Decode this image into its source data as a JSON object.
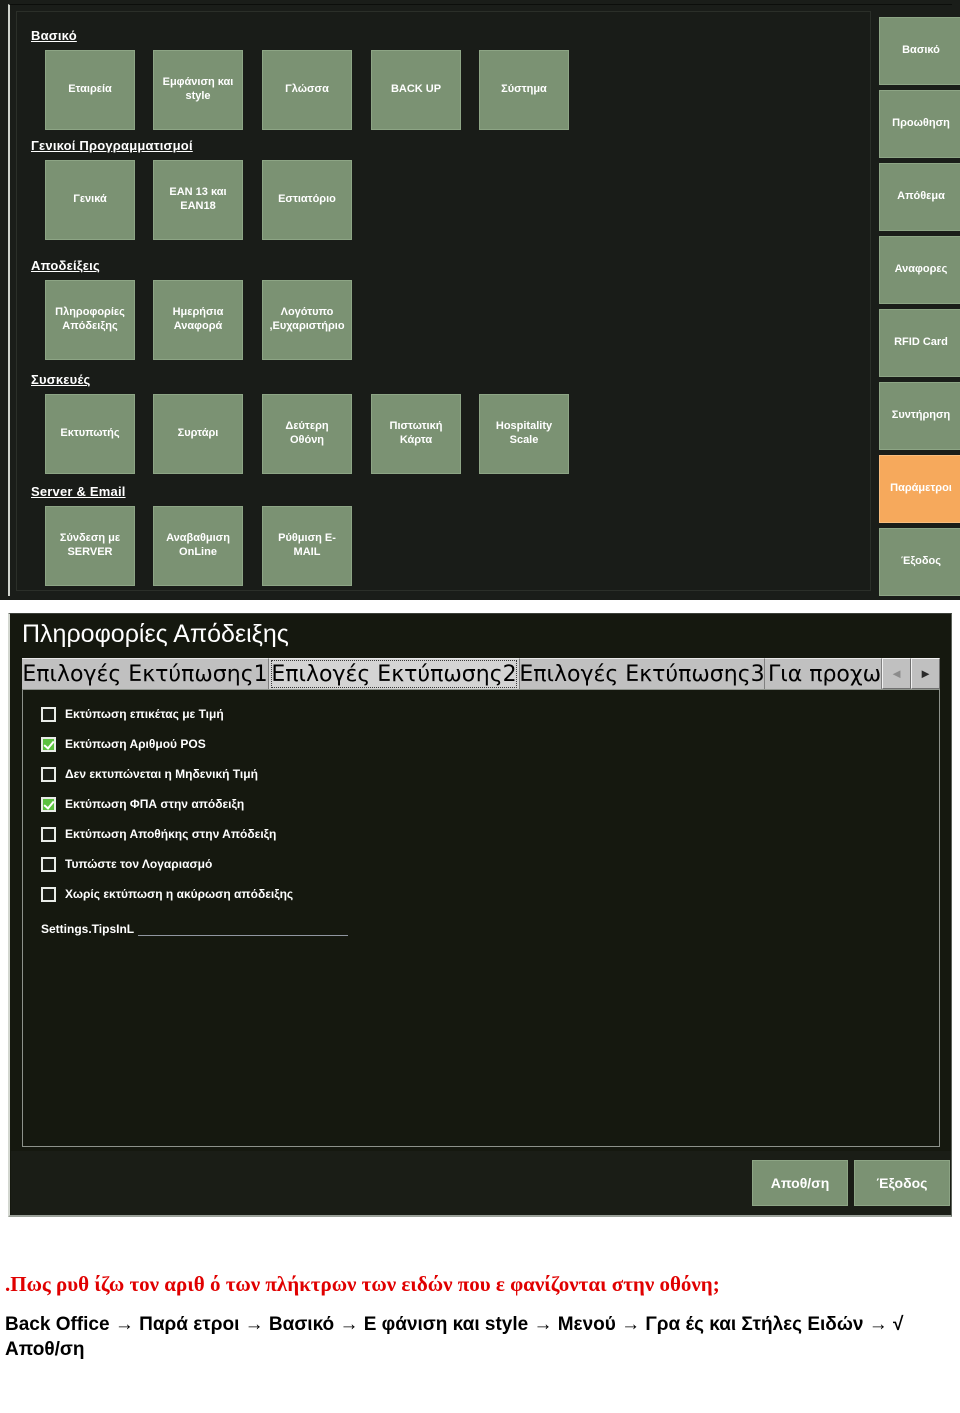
{
  "backoffice": {
    "groups": [
      {
        "name": "basiko",
        "header": "Βασικό",
        "tiles": [
          {
            "label": "Εταιρεία",
            "name": "tile-etaireia"
          },
          {
            "label": "Εμφάνιση και\nstyle",
            "name": "tile-emfanisi-style"
          },
          {
            "label": "Γλώσσα",
            "name": "tile-glossa"
          },
          {
            "label": "BACK UP",
            "name": "tile-backup"
          },
          {
            "label": "Σύστημα",
            "name": "tile-systima"
          }
        ]
      },
      {
        "name": "genikoi-programmatismoi",
        "header": "Γενικοί Προγραμματισμοί",
        "tiles": [
          {
            "label": "Γενικά",
            "name": "tile-genika"
          },
          {
            "label": "EAN 13 και\nEAN18",
            "name": "tile-ean13-ean18"
          },
          {
            "label": "Εστιατόριο",
            "name": "tile-estiatorio"
          }
        ]
      },
      {
        "name": "apodeixeis",
        "header": "Αποδείξεις",
        "tiles": [
          {
            "label": "Πληροφορίες\nΑπόδειξης",
            "name": "tile-plirofories-apodeixis"
          },
          {
            "label": "Ημερήσια\nΑναφορά",
            "name": "tile-imerisia-anafora"
          },
          {
            "label": "Λογότυπο\n,Ευχαριστήριο",
            "name": "tile-logotypo-euxaristirio"
          }
        ]
      },
      {
        "name": "syskeues",
        "header": "Συσκευές",
        "tiles": [
          {
            "label": "Εκτυπωτής",
            "name": "tile-ektypotis"
          },
          {
            "label": "Συρτάρι",
            "name": "tile-syrtari"
          },
          {
            "label": "Δεύτερη\nΟθόνη",
            "name": "tile-defteri-othoni"
          },
          {
            "label": "Πιστωτική\nΚάρτα",
            "name": "tile-pistotiki-karta"
          },
          {
            "label": "Hospitality\nScale",
            "name": "tile-hospitality-scale"
          }
        ]
      },
      {
        "name": "server-email",
        "header": "Server & Email",
        "tiles": [
          {
            "label": "Σύνδεση με\nSERVER",
            "name": "tile-syndesi-server"
          },
          {
            "label": "Αναβαθμιση\nOnLine",
            "name": "tile-anavathmisi-online"
          },
          {
            "label": "Ρύθμιση E-\nMAIL",
            "name": "tile-rythmisi-email"
          }
        ]
      }
    ],
    "sidebar": {
      "items": [
        {
          "label": "Βασικό",
          "name": "sidebar-basiko",
          "active": false
        },
        {
          "label": "Προωθηση",
          "name": "sidebar-proothisi",
          "active": false
        },
        {
          "label": "Απόθεμα",
          "name": "sidebar-apothema",
          "active": false
        },
        {
          "label": "Αναφορες",
          "name": "sidebar-anafores",
          "active": false
        },
        {
          "label": "RFID Card",
          "name": "sidebar-rfid-card",
          "active": false
        },
        {
          "label": "Συντήρηση",
          "name": "sidebar-syntirisi",
          "active": false
        },
        {
          "label": "Παράμετροι",
          "name": "sidebar-parametroi",
          "active": true
        },
        {
          "label": "Έξοδος",
          "name": "sidebar-exodos",
          "active": false
        }
      ],
      "active_color": "#f6a95c",
      "tile_color": "#7b9273"
    }
  },
  "dialog": {
    "title": "Πληροφορίες Απόδειξης",
    "tabs": [
      {
        "label": "Επιλογές Εκτύπωσης1",
        "selected": false,
        "name": "tab-print-options-1"
      },
      {
        "label": "Επιλογές Εκτύπωσης2",
        "selected": true,
        "name": "tab-print-options-2"
      },
      {
        "label": "Επιλογές Εκτύπωσης3",
        "selected": false,
        "name": "tab-print-options-3"
      },
      {
        "label": "Για προχωρημ",
        "selected": false,
        "name": "tab-gia-proxorimenous"
      }
    ],
    "tab_scroll_left": "◄",
    "tab_scroll_right": "►",
    "checkboxes": [
      {
        "label": "Εκτύπωση επικέτας με Τιμή",
        "checked": false,
        "name": "checkbox-print-label-with-price"
      },
      {
        "label": "Εκτύπωση Αριθμού POS",
        "checked": true,
        "name": "checkbox-print-pos-number"
      },
      {
        "label": "Δεν εκτυπώνεται η Μηδενική Τιμή",
        "checked": false,
        "name": "checkbox-no-zero-price"
      },
      {
        "label": "Εκτύπωση ΦΠΑ στην απόδειξη",
        "checked": true,
        "name": "checkbox-print-vat"
      },
      {
        "label": "Εκτύπωση Αποθήκης στην Απόδειξη",
        "checked": false,
        "name": "checkbox-print-warehouse"
      },
      {
        "label": "Τυπώστε τον Λογαριασμό",
        "checked": false,
        "name": "checkbox-print-bill"
      },
      {
        "label": "Χωρίς εκτύπωση η ακύρωση απόδειξης",
        "checked": false,
        "name": "checkbox-no-print-void"
      }
    ],
    "tips_field": {
      "label": "Settings.TipsInL",
      "value": "",
      "placeholder": ""
    },
    "footer": {
      "save_label": "Αποθ/ση",
      "exit_label": "Έξοδος"
    }
  },
  "caption": {
    "question": ".Πως ρυθ ίζω τον αριθ ό των πλήκτρων των ειδών που ε φανίζονται στην οθόνη;",
    "path": "Back Office → Παρά ετροι → Βασικό → Ε φάνιση και style → Μενού → Γρα ές και Στήλες Ειδών → √ Αποθ/ση"
  }
}
